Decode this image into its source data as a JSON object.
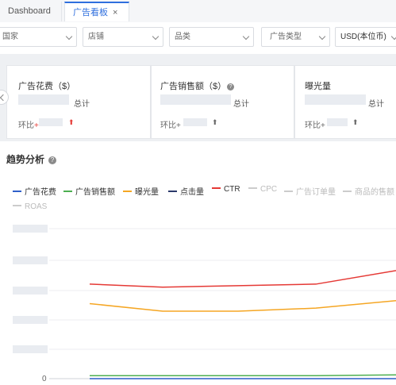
{
  "tabs": [
    {
      "label": "Dashboard"
    },
    {
      "label": "广告看板",
      "close": "×"
    }
  ],
  "filters": {
    "country": "国家",
    "shop": "店铺",
    "category": "品类",
    "ad_type": "广告类型",
    "currency": "USD(本位币)"
  },
  "kpis": [
    {
      "title": "广告花费（$）",
      "total_label": "总计",
      "mom_label": "环比",
      "mom_sign": "+",
      "arrow": "⬆",
      "arrow_color": "#e53935"
    },
    {
      "title": "广告销售额（$）",
      "help": "?",
      "total_label": "总计",
      "mom_label": "环比+",
      "arrow": "⬆",
      "arrow_color": "#666666"
    },
    {
      "title": "曝光量",
      "total_label": "总计",
      "mom_label": "环比+",
      "arrow": "⬆",
      "arrow_color": "#666666"
    }
  ],
  "trend": {
    "title": "趋势分析",
    "help": "?",
    "legend": [
      {
        "label": "广告花费",
        "color": "#2f5fc9",
        "active": true
      },
      {
        "label": "广告销售额",
        "color": "#4caf50",
        "active": true
      },
      {
        "label": "曝光量",
        "color": "#f5a623",
        "active": true
      },
      {
        "label": "点击量",
        "color": "#2b3a6b",
        "active": true
      },
      {
        "label": "CTR",
        "color": "#e53935",
        "active": true
      },
      {
        "label": "CPC",
        "color": "#cccccc",
        "active": false
      },
      {
        "label": "广告订单量",
        "color": "#cccccc",
        "active": false
      },
      {
        "label": "商品的售额",
        "color": "#cccccc",
        "active": false
      },
      {
        "label": "ROAS",
        "color": "#cccccc",
        "active": false
      }
    ]
  },
  "chart_data": {
    "type": "line",
    "y_tick_zero": "0",
    "series": [
      {
        "name": "CTR",
        "color": "#e53935",
        "values": [
          0.63,
          0.61,
          0.62,
          0.63,
          0.72
        ]
      },
      {
        "name": "曝光量",
        "color": "#f5a623",
        "values": [
          0.5,
          0.45,
          0.45,
          0.47,
          0.52
        ]
      },
      {
        "name": "广告销售额",
        "color": "#4caf50",
        "values": [
          0.02,
          0.02,
          0.02,
          0.02,
          0.025
        ]
      },
      {
        "name": "广告花费",
        "color": "#2f5fc9",
        "values": [
          0.0,
          0.0,
          0.0,
          0.0,
          0.0
        ]
      }
    ]
  }
}
